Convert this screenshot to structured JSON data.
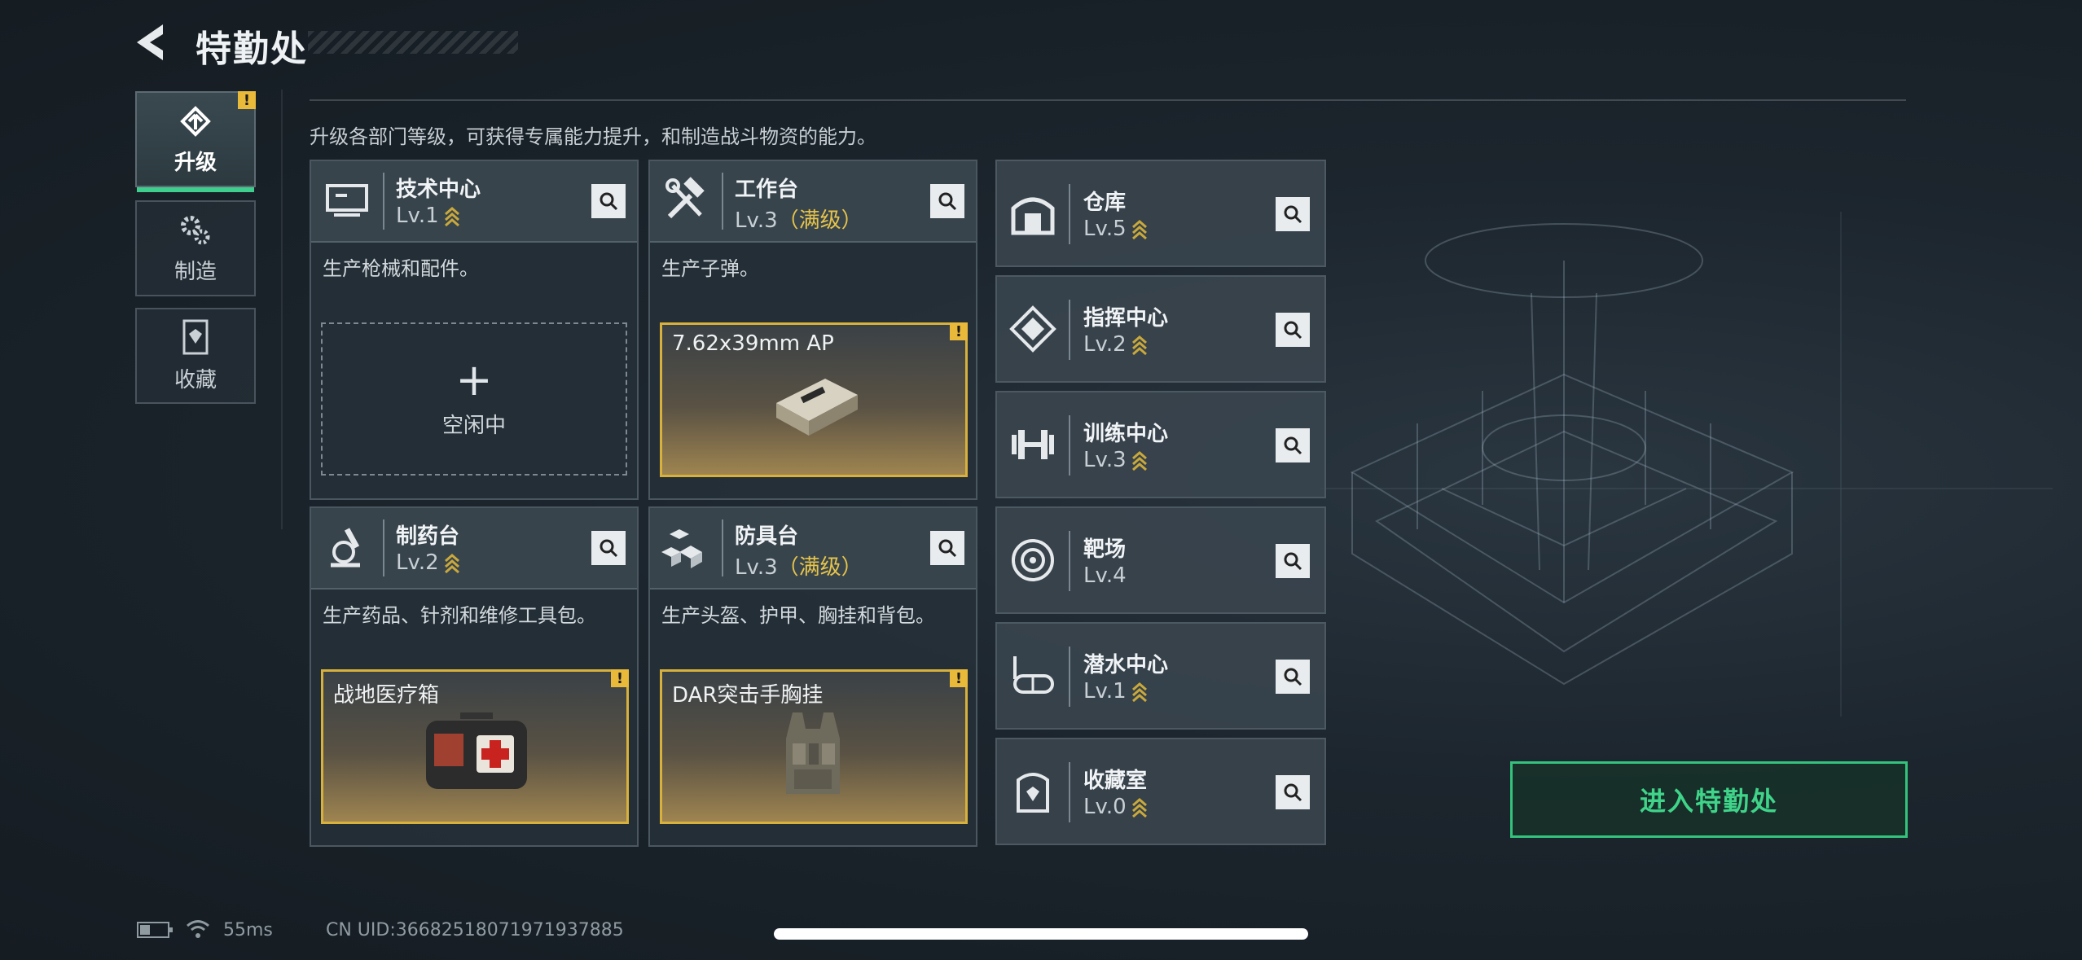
{
  "header": {
    "title": "特勤处"
  },
  "sidebar": {
    "tabs": [
      {
        "label": "升级",
        "icon": "upgrade-icon",
        "active": true,
        "alert": "!"
      },
      {
        "label": "制造",
        "icon": "gears-icon",
        "active": false
      },
      {
        "label": "收藏",
        "icon": "collection-icon",
        "active": false
      }
    ]
  },
  "description": "升级各部门等级，可获得专属能力提升，和制造战斗物资的能力。",
  "departments": [
    {
      "name": "技术中心",
      "level": "Lv.1",
      "max_label": "",
      "icon": "monitor-icon",
      "desc": "生产枪械和配件。",
      "slot": {
        "state": "empty",
        "plus": "+",
        "label": "空闲中"
      }
    },
    {
      "name": "工作台",
      "level": "Lv.3",
      "max_label": "（满级）",
      "icon": "hammer-wrench-icon",
      "desc": "生产子弹。",
      "slot": {
        "state": "item",
        "label": "7.62x39mm AP",
        "alert": "!"
      }
    },
    {
      "name": "制药台",
      "level": "Lv.2",
      "max_label": "",
      "icon": "microscope-icon",
      "desc": "生产药品、针剂和维修工具包。",
      "slot": {
        "state": "item",
        "label": "战地医疗箱",
        "alert": "!"
      }
    },
    {
      "name": "防具台",
      "level": "Lv.3",
      "max_label": "（满级）",
      "icon": "armor-cubes-icon",
      "desc": "生产头盔、护甲、胸挂和背包。",
      "slot": {
        "state": "item",
        "label": "DAR突击手胸挂",
        "alert": "!"
      }
    }
  ],
  "facilities": [
    {
      "name": "仓库",
      "level": "Lv.5",
      "icon": "warehouse-icon",
      "upgradable": true
    },
    {
      "name": "指挥中心",
      "level": "Lv.2",
      "icon": "command-icon",
      "upgradable": true
    },
    {
      "name": "训练中心",
      "level": "Lv.3",
      "icon": "dumbbell-icon",
      "upgradable": true
    },
    {
      "name": "靶场",
      "level": "Lv.4",
      "icon": "target-icon",
      "upgradable": false
    },
    {
      "name": "潜水中心",
      "level": "Lv.1",
      "icon": "diving-mask-icon",
      "upgradable": true
    },
    {
      "name": "收藏室",
      "level": "Lv.0",
      "icon": "collection-icon",
      "upgradable": true
    }
  ],
  "enter_button": "进入特勤处",
  "status": {
    "ping": "55ms",
    "uid": "CN UID:3668251807197193788​5"
  },
  "colors": {
    "accent_green": "#3ecf8e",
    "max_yellow": "#e6c44a",
    "alert_yellow": "#e9b93a"
  }
}
